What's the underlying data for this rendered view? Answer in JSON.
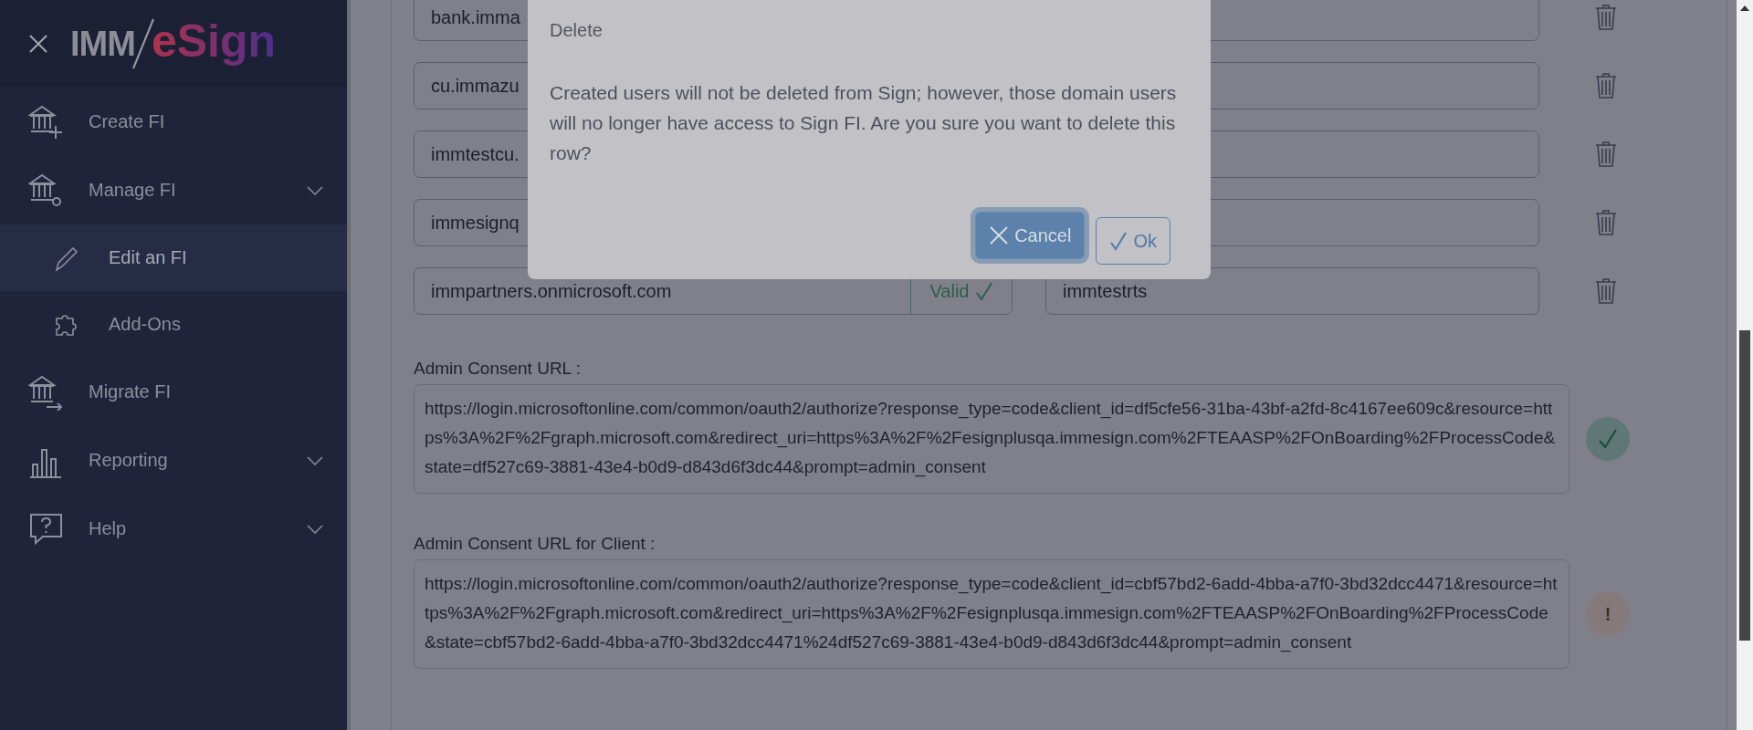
{
  "logo": {
    "prefix": "IMM",
    "name": "eSign"
  },
  "sidebar": {
    "items": [
      {
        "label": "Create FI",
        "selected": false
      },
      {
        "label": "Manage FI",
        "selected": false,
        "collapsible": true,
        "children": [
          {
            "label": "Edit an FI",
            "selected": true
          },
          {
            "label": "Add-Ons",
            "selected": false
          }
        ]
      },
      {
        "label": "Migrate FI",
        "selected": false
      },
      {
        "label": "Reporting",
        "selected": false,
        "collapsible": true
      },
      {
        "label": "Help",
        "selected": false,
        "collapsible": true
      }
    ]
  },
  "domains": [
    {
      "domain": "bank.imma"
    },
    {
      "domain": "cu.immazu"
    },
    {
      "domain": "immtestcu."
    },
    {
      "domain": "immesignq"
    },
    {
      "domain": "immpartners.onmicrosoft.com",
      "status": "Valid",
      "valid": true,
      "tenant": "immtestrts"
    }
  ],
  "consent_urls": [
    {
      "label": "Admin Consent URL :",
      "value": "https://login.microsoftonline.com/common/oauth2/authorize?response_type=code&client_id=df5cfe56-31ba-43bf-a2fd-8c4167ee609c&resource=https%3A%2F%2Fgraph.microsoft.com&redirect_uri=https%3A%2F%2Fesignplusqa.immesign.com%2FTEAASP%2FOnBoarding%2FProcessCode&state=df527c69-3881-43e4-b0d9-d843d6f3dc44&prompt=admin_consent",
      "kind": "ok"
    },
    {
      "label": "Admin Consent URL for Client :",
      "value": "https://login.microsoftonline.com/common/oauth2/authorize?response_type=code&client_id=cbf57bd2-6add-4bba-a7f0-3bd32dcc4471&resource=https%3A%2F%2Fgraph.microsoft.com&redirect_uri=https%3A%2F%2Fesignplusqa.immesign.com%2FTEAASP%2FOnBoarding%2FProcessCode&state=cbf57bd2-6add-4bba-a7f0-3bd32dcc4471%24df527c69-3881-43e4-b0d9-d843d6f3dc44&prompt=admin_consent",
      "kind": "warning",
      "symbol": "!"
    }
  ],
  "dialog": {
    "title": "Delete",
    "message": "Created users will not be deleted from Sign; however, those domain users will no longer have access to Sign FI. Are you sure you want to delete this row?",
    "buttons": [
      {
        "label": "Cancel",
        "kind": "cancel"
      },
      {
        "label": "Ok",
        "kind": "ok"
      }
    ]
  }
}
